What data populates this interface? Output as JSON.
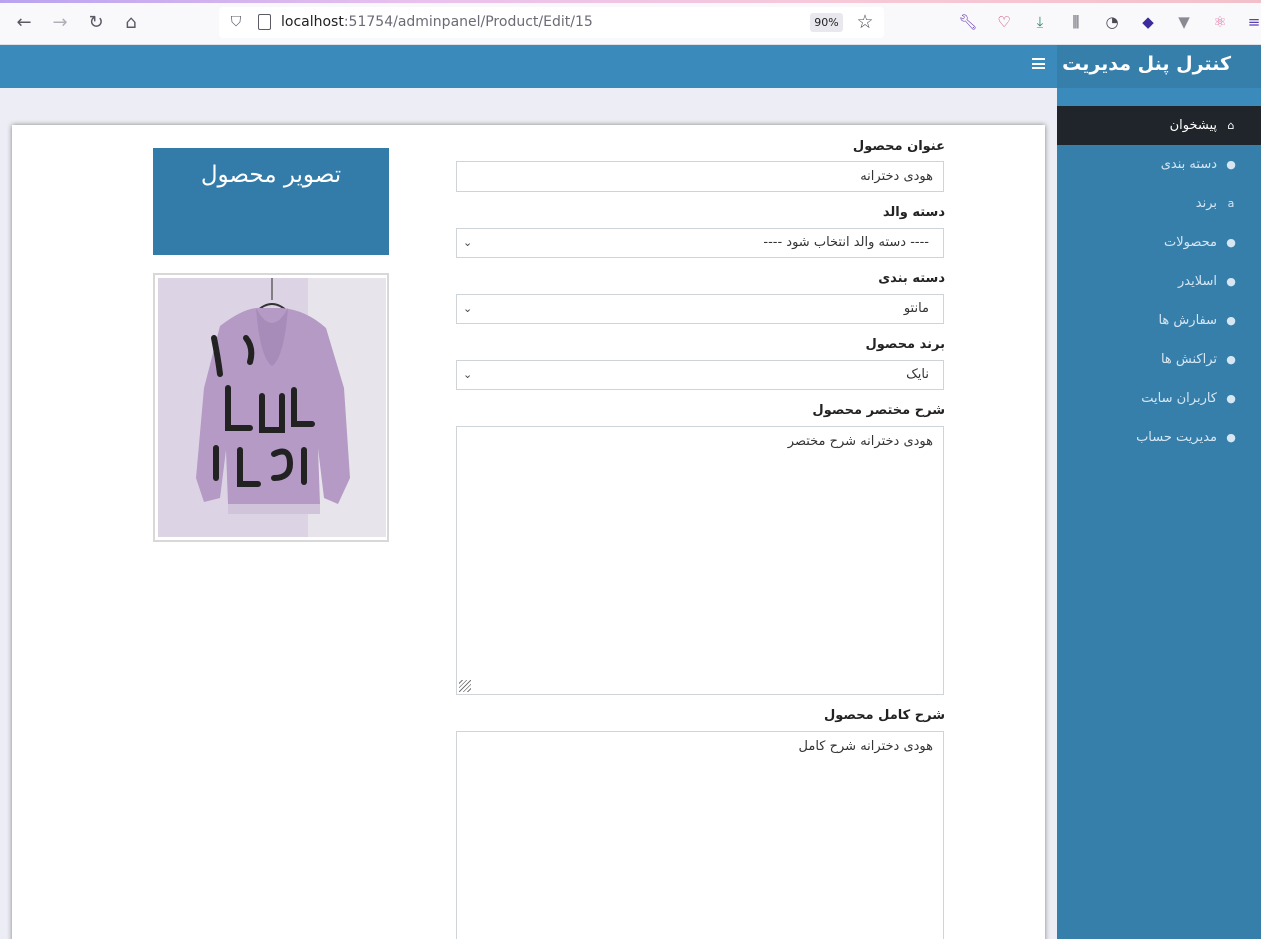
{
  "browser": {
    "url_host": "localhost",
    "url_path": ":51754/adminpanel/Product/Edit/15",
    "zoom": "90%"
  },
  "sidebar": {
    "brand": "کنترل پنل مدیریت",
    "items": [
      {
        "label": "پیشخوان",
        "icon": "home-icon",
        "active": true
      },
      {
        "label": "دسته بندی",
        "icon": "comment-icon",
        "active": false
      },
      {
        "label": "برند",
        "icon": "amazon-icon",
        "active": false
      },
      {
        "label": "محصولات",
        "icon": "comment-icon",
        "active": false
      },
      {
        "label": "اسلایدر",
        "icon": "comment-icon",
        "active": false
      },
      {
        "label": "سفارش ها",
        "icon": "comment-icon",
        "active": false
      },
      {
        "label": "تراکنش ها",
        "icon": "comment-icon",
        "active": false
      },
      {
        "label": "کاربران سایت",
        "icon": "comment-icon",
        "active": false
      },
      {
        "label": "مدیریت حساب",
        "icon": "comment-icon",
        "active": false
      }
    ]
  },
  "form": {
    "title_label": "عنوان محصول",
    "title_value": "هودی دخترانه",
    "parent_label": "دسته والد",
    "parent_value": "---- دسته والد انتخاب شود ----",
    "category_label": "دسته بندی",
    "category_value": "مانتو",
    "brand_label": "برند محصول",
    "brand_value": "نایک",
    "short_desc_label": "شرح مختصر محصول",
    "short_desc_value": "هودی دخترانه شرح مختصر",
    "full_desc_label": "شرح کامل محصول",
    "full_desc_value": "هودی دخترانه شرح کامل"
  },
  "image_panel": {
    "title": "تصویر محصول"
  },
  "colors": {
    "header": "#3a8bbb",
    "sidebar": "#367fab",
    "active_item": "#1f252b",
    "image_header": "#337ba8"
  }
}
